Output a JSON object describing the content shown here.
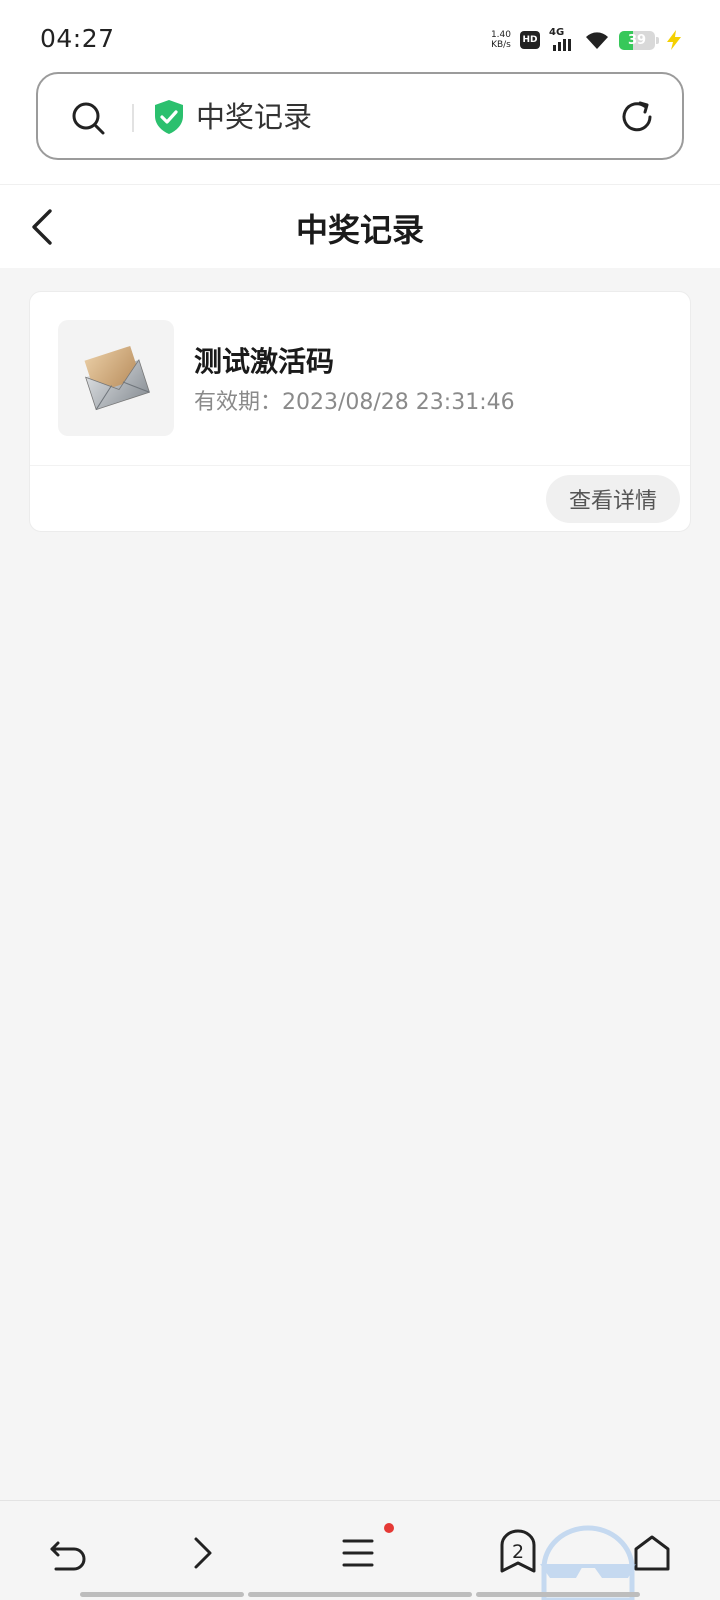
{
  "status_bar": {
    "time": "04:27",
    "net_speed_value": "1.40",
    "net_speed_unit": "KB/s",
    "hd_label": "HD",
    "network_type": "4G",
    "battery_level": 39,
    "battery_label": "39",
    "colors": {
      "battery_fill": "#37c85a",
      "charging": "#f4d000"
    }
  },
  "address_bar": {
    "text": "中奖记录",
    "icons": [
      "search-icon",
      "shield-check-icon",
      "refresh-icon"
    ],
    "colors": {
      "shield": "#2bc06e"
    }
  },
  "header": {
    "title": "中奖记录",
    "back_icon": "chevron-left-icon"
  },
  "records": [
    {
      "name": "测试激活码",
      "expiry": "有效期：2023/08/28 23:31:46",
      "thumbnail_icon": "envelope-icon",
      "detail_label": "查看详情"
    }
  ],
  "bottom_bar": {
    "icons": [
      "undo-icon",
      "chevron-right-icon",
      "menu-icon",
      "tabs-icon",
      "home-icon"
    ],
    "tab_count": "2",
    "menu_badge_color": "#e53935"
  }
}
